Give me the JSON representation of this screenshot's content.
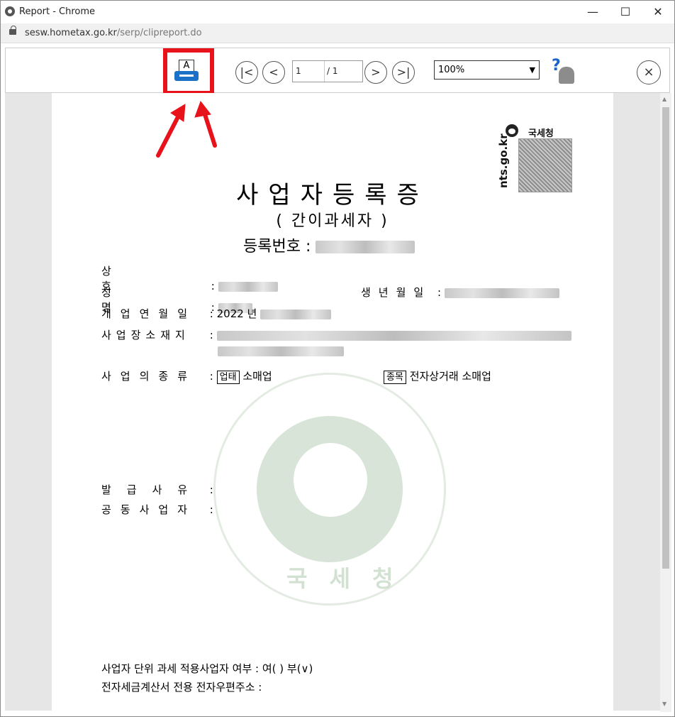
{
  "window": {
    "title": "Report - Chrome",
    "url_host": "sesw.hometax.go.kr",
    "url_path": "/serp/clipreport.do"
  },
  "toolbar": {
    "print_paper_letter": "A",
    "first_page_glyph": "|<",
    "prev_page_glyph": "<",
    "current_page": "1",
    "total_pages": "/ 1",
    "next_page_glyph": ">",
    "last_page_glyph": ">|",
    "zoom_value": "100%",
    "help_glyph": "?",
    "close_glyph": "×"
  },
  "document": {
    "agency_name": "국세청",
    "site_vertical": "nts.go.kr",
    "title": "사업자등록증",
    "subtitle": "( 간이과세자 )",
    "reg_no_label": "등록번호 :",
    "fields": {
      "trade_name_label": "상 호",
      "name_label": "성 명",
      "birth_label": "생년월일",
      "open_date_label": "개업연월일",
      "open_date_value": "2022 년",
      "address_label": "사업장소재지",
      "business_type_label": "사업의종류",
      "business_tag": "업태",
      "business_value": "소매업",
      "item_tag": "종목",
      "item_value": "전자상거래 소매업",
      "issue_reason_label": "발급사유",
      "joint_label": "공동사업자",
      "unit_tax_label": "사업자 단위 과세 적용사업자 여부 : 여(  ) 부(∨)",
      "email_label": "전자세금계산서 전용 전자우편주소 :"
    },
    "seal_text": "국 세 청"
  },
  "colors": {
    "highlight": "#e8121b",
    "printer_blue": "#1b70c8",
    "help_blue": "#1b63c8"
  }
}
